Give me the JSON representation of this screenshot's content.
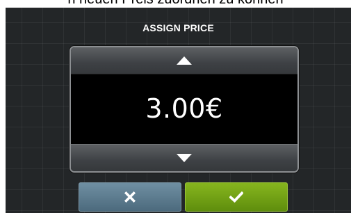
{
  "document_caption": "n neuen Preis zuordnen zu können",
  "dialog": {
    "title": "ASSIGN PRICE",
    "price_value": "3.00€",
    "increase_icon": "triangle-up-icon",
    "decrease_icon": "triangle-down-icon",
    "cancel_icon": "close-x-icon",
    "confirm_icon": "checkmark-icon"
  },
  "colors": {
    "background": "#232628",
    "panel": "#000000",
    "cancel_button": "#5b7a8d",
    "confirm_button": "#76a315"
  }
}
